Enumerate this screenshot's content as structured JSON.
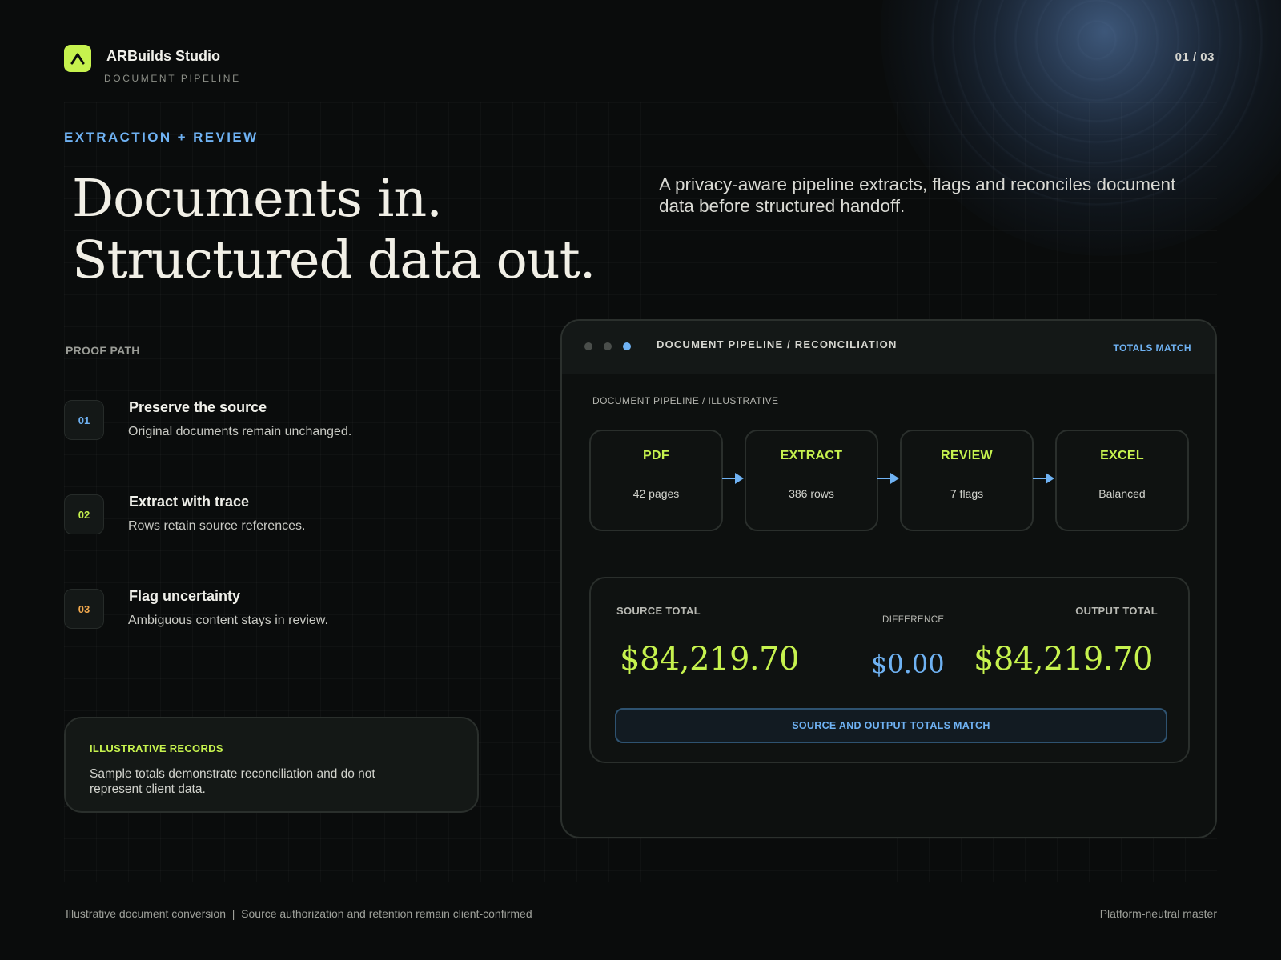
{
  "header": {
    "brand": "ARBuilds Studio",
    "brand_sub": "DOCUMENT PIPELINE",
    "page_indicator": "01 / 03",
    "logo_icon": "chevron-up-icon"
  },
  "hero": {
    "eyebrow": "EXTRACTION + REVIEW",
    "headline_line1": "Documents in.",
    "headline_line2": "Structured data out.",
    "intro": "A privacy-aware pipeline extracts, flags and reconciles document data before structured handoff."
  },
  "proof": {
    "label": "PROOF PATH",
    "steps": [
      {
        "num": "01",
        "title": "Preserve the source",
        "desc": "Original documents remain unchanged.",
        "color": "#6fb2f3"
      },
      {
        "num": "02",
        "title": "Extract with trace",
        "desc": "Rows retain source references.",
        "color": "#c6f24e"
      },
      {
        "num": "03",
        "title": "Flag uncertainty",
        "desc": "Ambiguous content stays in review.",
        "color": "#f2a94e"
      }
    ]
  },
  "records": {
    "title": "ILLUSTRATIVE RECORDS",
    "text": "Sample totals demonstrate reconciliation and do not represent client data."
  },
  "panel": {
    "title": "DOCUMENT PIPELINE / RECONCILIATION",
    "status": "TOTALS MATCH",
    "subtitle": "DOCUMENT PIPELINE / ILLUSTRATIVE",
    "stages": [
      {
        "name": "PDF",
        "meta": "42 pages"
      },
      {
        "name": "EXTRACT",
        "meta": "386 rows"
      },
      {
        "name": "REVIEW",
        "meta": "7 flags"
      },
      {
        "name": "EXCEL",
        "meta": "Balanced"
      }
    ],
    "totals": {
      "source_label": "SOURCE TOTAL",
      "source_value": "$84,219.70",
      "diff_label": "DIFFERENCE",
      "diff_value": "$0.00",
      "output_label": "OUTPUT TOTAL",
      "output_value": "$84,219.70",
      "match_text": "SOURCE AND OUTPUT TOTALS MATCH"
    }
  },
  "footer": {
    "left": "Illustrative document conversion  |  Source authorization and retention remain client-confirmed",
    "right": "Platform-neutral master"
  },
  "colors": {
    "accent_lime": "#c6f24e",
    "accent_blue": "#6fb2f3",
    "accent_orange": "#f2a94e",
    "background": "#0a0c0c"
  }
}
